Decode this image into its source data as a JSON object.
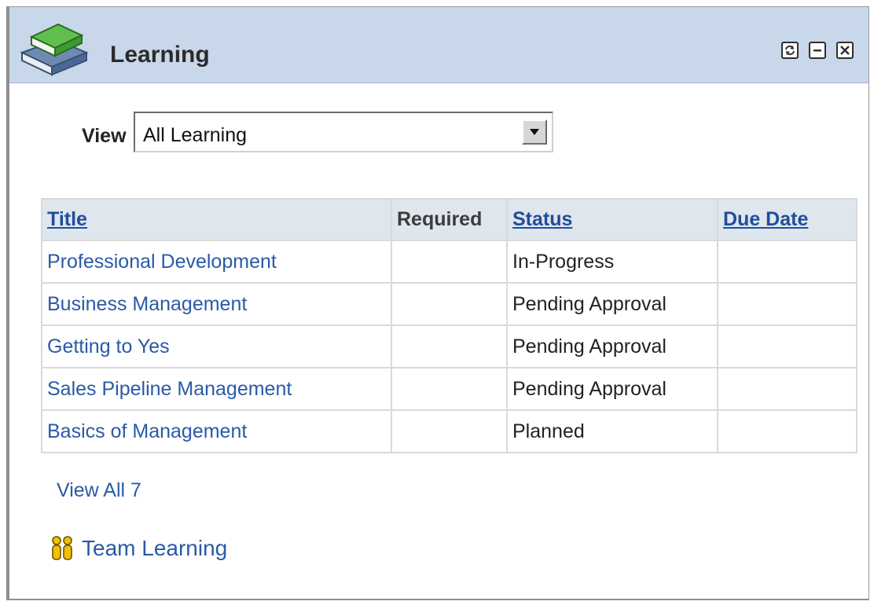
{
  "pagelet": {
    "title": "Learning",
    "actions": {
      "refresh_icon": "refresh-icon",
      "minimize_icon": "minimize-icon",
      "close_icon": "close-icon"
    }
  },
  "filter": {
    "label": "View",
    "selected": "All Learning"
  },
  "table": {
    "headers": {
      "title": "Title",
      "required": "Required",
      "status": "Status",
      "due_date": "Due Date"
    },
    "rows": [
      {
        "title": "Professional Development",
        "required": "",
        "status": "In-Progress",
        "due_date": ""
      },
      {
        "title": "Business Management",
        "required": "",
        "status": "Pending Approval",
        "due_date": ""
      },
      {
        "title": "Getting to Yes",
        "required": "",
        "status": "Pending Approval",
        "due_date": ""
      },
      {
        "title": "Sales Pipeline Management",
        "required": "",
        "status": "Pending Approval",
        "due_date": ""
      },
      {
        "title": "Basics of Management",
        "required": "",
        "status": "Planned",
        "due_date": ""
      }
    ]
  },
  "links": {
    "view_all": "View All 7",
    "team_learning": "Team Learning"
  },
  "colors": {
    "header_bg": "#c8d7ea",
    "link": "#2a5aa8",
    "table_header_bg": "#dfe6ee"
  }
}
